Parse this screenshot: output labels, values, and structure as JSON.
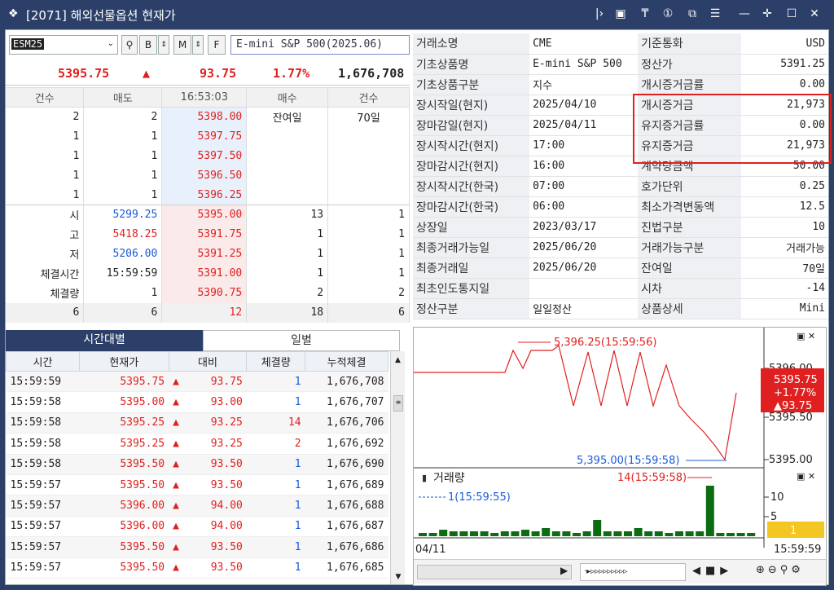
{
  "window": {
    "title": "[2071] 해외선물옵션 현재가"
  },
  "search": {
    "code": "ESM25",
    "product": "E-mini S&P 500(2025.06)",
    "btn_b": "B",
    "btn_m": "M",
    "btn_f": "F"
  },
  "quote": {
    "price": "5395.75",
    "change": "93.75",
    "rate": "1.77%",
    "volume": "1,676,708"
  },
  "orderbook": {
    "headers": [
      "건수",
      "매도",
      "16:53:03",
      "매수",
      "건수"
    ],
    "asks": [
      [
        "2",
        "2",
        "5398.00"
      ],
      [
        "1",
        "1",
        "5397.75"
      ],
      [
        "1",
        "1",
        "5397.50"
      ],
      [
        "1",
        "1",
        "5396.50"
      ],
      [
        "1",
        "1",
        "5396.25"
      ]
    ],
    "remain_label": "잔여일",
    "remain_value": "70일",
    "stats": [
      [
        "시",
        "5299.25"
      ],
      [
        "고",
        "5418.25"
      ],
      [
        "저",
        "5206.00"
      ],
      [
        "체결시간",
        "15:59:59"
      ],
      [
        "체결량",
        "1"
      ]
    ],
    "bids": [
      [
        "5395.00",
        "13",
        "1"
      ],
      [
        "5391.75",
        "1",
        "1"
      ],
      [
        "5391.25",
        "1",
        "1"
      ],
      [
        "5391.00",
        "1",
        "1"
      ],
      [
        "5390.75",
        "2",
        "2"
      ]
    ],
    "totals": [
      "6",
      "6",
      "12",
      "18",
      "6"
    ]
  },
  "info": [
    [
      "거래소명",
      "CME",
      "기준통화",
      "USD"
    ],
    [
      "기초상품명",
      "E-mini S&P 500",
      "정산가",
      "5391.25"
    ],
    [
      "기초상품구분",
      "지수",
      "개시증거금률",
      "0.00"
    ],
    [
      "장시작일(현지)",
      "2025/04/10",
      "개시증거금",
      "21,973"
    ],
    [
      "장마감일(현지)",
      "2025/04/11",
      "유지증거금률",
      "0.00"
    ],
    [
      "장시작시간(현지)",
      "17:00",
      "유지증거금",
      "21,973"
    ],
    [
      "장마감시간(현지)",
      "16:00",
      "계약당금액",
      "50.00"
    ],
    [
      "장시작시간(한국)",
      "07:00",
      "호가단위",
      "0.25"
    ],
    [
      "장마감시간(한국)",
      "06:00",
      "최소가격변동액",
      "12.5"
    ],
    [
      "상장일",
      "2023/03/17",
      "진법구분",
      "10"
    ],
    [
      "최종거래가능일",
      "2025/06/20",
      "거래가능구분",
      "거래가능"
    ],
    [
      "최종거래일",
      "2025/06/20",
      "잔여일",
      "70일"
    ],
    [
      "최초인도통지일",
      "",
      "시차",
      "-14"
    ],
    [
      "정산구분",
      "일일정산",
      "상품상세",
      "Mini"
    ]
  ],
  "tabs": [
    "시간대별",
    "일별"
  ],
  "ticks": {
    "headers": [
      "시간",
      "현재가",
      "대비",
      "체결량",
      "누적체결"
    ],
    "rows": [
      [
        "15:59:59",
        "5395.75",
        "93.75",
        "1",
        "1,676,708"
      ],
      [
        "15:59:58",
        "5395.00",
        "93.00",
        "1",
        "1,676,707"
      ],
      [
        "15:59:58",
        "5395.25",
        "93.25",
        "14",
        "1,676,706"
      ],
      [
        "15:59:58",
        "5395.25",
        "93.25",
        "2",
        "1,676,692"
      ],
      [
        "15:59:58",
        "5395.50",
        "93.50",
        "1",
        "1,676,690"
      ],
      [
        "15:59:57",
        "5395.50",
        "93.50",
        "1",
        "1,676,689"
      ],
      [
        "15:59:57",
        "5396.00",
        "94.00",
        "1",
        "1,676,688"
      ],
      [
        "15:59:57",
        "5396.00",
        "94.00",
        "1",
        "1,676,687"
      ],
      [
        "15:59:57",
        "5395.50",
        "93.50",
        "1",
        "1,676,686"
      ],
      [
        "15:59:57",
        "5395.50",
        "93.50",
        "1",
        "1,676,685"
      ]
    ]
  },
  "chart": {
    "high_label": "5,396.25(15:59:56)",
    "low_label": "5,395.00(15:59:58)",
    "y_tick_top": "5396.00",
    "y_tick_mid": "5395.50",
    "y_tick_bot": "5395.00",
    "badge_price": "5395.75",
    "badge_rate": "+1.77%",
    "badge_chg": "▲93.75",
    "vol_title": "거래량",
    "vol_max_label": "14(15:59:58)",
    "vol_min_label": "1(15:59:55)",
    "vol_tick_10": "10",
    "vol_tick_5": "5",
    "vol_badge": "1",
    "x_start": "04/11",
    "x_end": "15:59:59"
  }
}
